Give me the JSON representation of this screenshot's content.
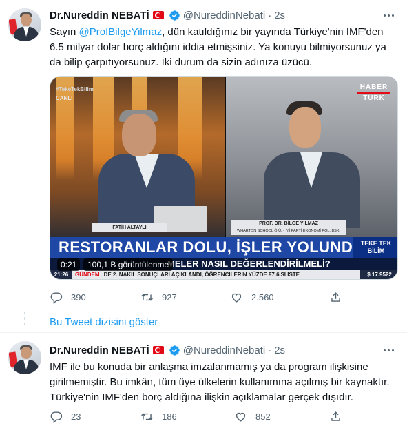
{
  "tweets": [
    {
      "author_name": "Dr.Nureddin NEBATİ",
      "handle": "@NureddinNebati",
      "separator": "·",
      "time": "2s",
      "text_parts": {
        "before": "Sayın ",
        "mention": "@ProfBilgeYilmaz",
        "after": ", dün katıldığınız bir yayında Türkiye'nin IMF'den 6.5 milyar dolar borç aldığını iddia etmişsiniz. Ya konuyu bilmiyorsunuz ya da bilip çarpıtıyorsunuz. İki durum da sizin adınıza üzücü."
      },
      "video": {
        "hashtag": "#TekeTekBilim",
        "live_label": "CANLI",
        "channel_logo_line1": "HABER",
        "channel_logo_line2": "TÜRK",
        "left_guest": "FATİH ALTAYLI",
        "right_guest": "PROF. DR. BİLGE YILMAZ",
        "right_guest_sub": "WHARTON SCHOOL Ö.Ü. - İYİ PARTİ EKONOMİ POL. BŞK.",
        "headline": "RESTORANLAR DOLU, İŞLER YOLUNDA MI?",
        "program_line1": "TEKE TEK",
        "program_line2": "BİLİM",
        "subheadline": "MELER NASIL DEĞERLENDİRİLMELİ?",
        "ticker_clock": "21:26",
        "ticker_section": "GÜNDEM",
        "ticker_text": "DE 2. NAKİL SONUÇLARI AÇIKLANDI, ÖĞRENCİLERİN YÜZDE 97.6'SI İSTE",
        "ticker_stock": "$ 17.9522",
        "duration": "0:21",
        "views": "100,1 B görüntülenme"
      },
      "replies": "390",
      "retweets": "927",
      "likes": "2.560"
    },
    {
      "author_name": "Dr.Nureddin NEBATİ",
      "handle": "@NureddinNebati",
      "separator": "·",
      "time": "2s",
      "text": "IMF ile bu konuda bir anlaşma imzalanmamış ya da program ilişkisine girilmemiştir. Bu imkân, tüm üye ülkelerin kullanımına açılmış bir kaynaktır. Türkiye'nin IMF'den borç aldığına ilişkin açıklamalar gerçek dışıdır.",
      "replies": "23",
      "retweets": "186",
      "likes": "852"
    }
  ],
  "show_thread_label": "Bu Tweet dizisini göster",
  "colors": {
    "link": "#1d9bf0",
    "muted": "#536471",
    "text": "#0f1419",
    "headline_bar": "#1f47a6"
  },
  "icons": [
    "verified-badge-icon",
    "turkey-flag-icon",
    "more-icon",
    "reply-icon",
    "retweet-icon",
    "like-icon",
    "share-icon"
  ]
}
